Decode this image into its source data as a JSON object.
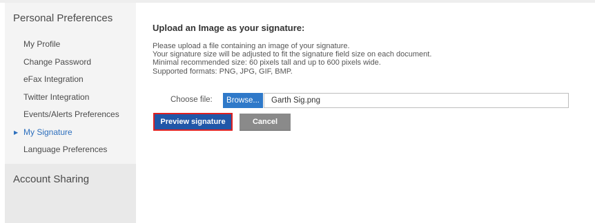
{
  "sidebar": {
    "section_title": "Personal Preferences",
    "items": [
      {
        "label": "My Profile"
      },
      {
        "label": "Change Password"
      },
      {
        "label": "eFax Integration"
      },
      {
        "label": "Twitter Integration"
      },
      {
        "label": "Events/Alerts Preferences"
      },
      {
        "label": "My Signature",
        "active": true
      },
      {
        "label": "Language Preferences"
      }
    ],
    "account_sharing": "Account Sharing"
  },
  "main": {
    "heading": "Upload an Image as your signature:",
    "description": [
      "Please upload a file containing an image of your signature.",
      "Your signature size will be adjusted to fit the signature field size on each document.",
      "Minimal recommended size: 60 pixels tall and up to 600 pixels wide.",
      "Supported formats: PNG, JPG, GIF, BMP."
    ],
    "file_label": "Choose file:",
    "browse_label": "Browse...",
    "file_name": "Garth Sig.png",
    "preview_label": "Preview signature",
    "cancel_label": "Cancel"
  },
  "colors": {
    "accent_blue": "#2f79c9",
    "active_link": "#2d6fbd",
    "highlight_border": "#e02020",
    "cancel_gray": "#8a8a8a"
  }
}
